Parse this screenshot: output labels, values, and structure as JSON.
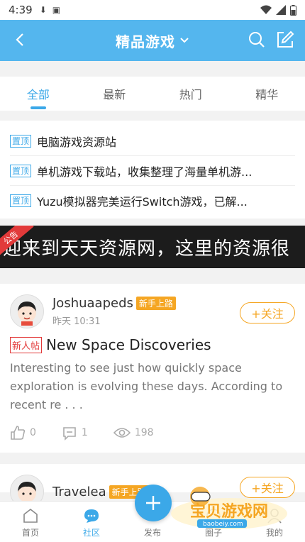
{
  "status_bar": {
    "time": "4:39"
  },
  "header": {
    "title": "精品游戏"
  },
  "tabs": [
    {
      "label": "全部",
      "active": true
    },
    {
      "label": "最新",
      "active": false
    },
    {
      "label": "热门",
      "active": false
    },
    {
      "label": "精华",
      "active": false
    }
  ],
  "pinned": {
    "badge": "置顶",
    "items": [
      "电脑游戏资源站",
      "单机游戏下载站，收集整理了海量单机游...",
      "Yuzu模拟器完美运行Switch游戏，已解..."
    ]
  },
  "announcement": {
    "corner_label": "公告",
    "text": "迎来到天天资源网，这里的资源很"
  },
  "post": {
    "username": "Joshuaapeds",
    "level_badge": "新手上路",
    "time": "昨天 10:31",
    "follow_label": "+关注",
    "new_badge": "新人帖",
    "title": "New Space Discoveries",
    "excerpt": "Interesting to see just how quickly space exploration is evolving these days. According to recent re . . .",
    "likes": "0",
    "comments": "1",
    "views": "198"
  },
  "post2": {
    "username": "Travelea",
    "level_badge": "新手上路",
    "follow_label": "+关注"
  },
  "bottom_nav": {
    "home": "首页",
    "community": "社区",
    "publish": "发布",
    "circle": "圈子",
    "mine": "我的"
  },
  "watermark": {
    "text": "宝贝游戏网",
    "url": "baobeiy.com"
  },
  "colors": {
    "accent": "#3ba8e8",
    "header": "#54b6ee",
    "badge_orange": "#f5a623",
    "badge_red": "#e23a3a"
  }
}
